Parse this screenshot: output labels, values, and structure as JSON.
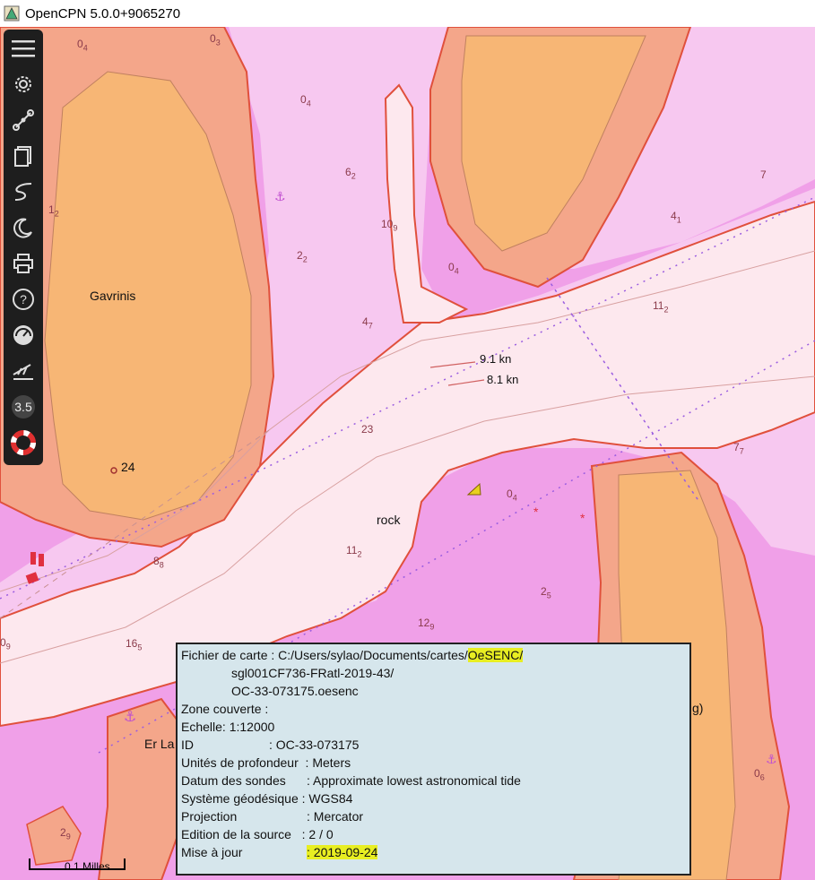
{
  "window": {
    "title": "OpenCPN 5.0.0+9065270"
  },
  "toolbar": {
    "items": [
      {
        "name": "menu",
        "icon": "hamburger-icon"
      },
      {
        "name": "options",
        "icon": "gear-icon"
      },
      {
        "name": "route",
        "icon": "route-icon"
      },
      {
        "name": "route-manager",
        "icon": "documents-icon"
      },
      {
        "name": "track",
        "icon": "track-icon"
      },
      {
        "name": "color-scheme",
        "icon": "moon-icon"
      },
      {
        "name": "print",
        "icon": "printer-icon"
      },
      {
        "name": "help",
        "icon": "help-icon"
      },
      {
        "name": "dashboard",
        "icon": "dashboard-icon"
      },
      {
        "name": "tides",
        "icon": "tide-icon"
      },
      {
        "name": "scale",
        "icon": "scale-icon",
        "label": "3.5"
      },
      {
        "name": "mob",
        "icon": "lifebuoy-icon"
      }
    ]
  },
  "map": {
    "labels": {
      "gavrinis": "Gavrinis",
      "rock": "rock",
      "current1": "9.1 kn",
      "current2": "8.1 kn",
      "peak": "24",
      "er_lan": "Er La",
      "g": "g)"
    },
    "soundings": [
      {
        "main": "0",
        "sub": "4"
      },
      {
        "main": "0",
        "sub": "3"
      },
      {
        "main": "0",
        "sub": "4"
      },
      {
        "main": "6",
        "sub": "2"
      },
      {
        "main": "1",
        "sub": "2"
      },
      {
        "main": "10",
        "sub": "9"
      },
      {
        "main": "2",
        "sub": "2"
      },
      {
        "main": "4",
        "sub": "7"
      },
      {
        "main": "0",
        "sub": "4"
      },
      {
        "main": "4",
        "sub": "1"
      },
      {
        "main": "7",
        "sub": ""
      },
      {
        "main": "11",
        "sub": "2"
      },
      {
        "main": "23",
        "sub": ""
      },
      {
        "main": "7",
        "sub": "7"
      },
      {
        "main": "0",
        "sub": "4"
      },
      {
        "main": "11",
        "sub": "2"
      },
      {
        "main": "8",
        "sub": "8"
      },
      {
        "main": "2",
        "sub": "5"
      },
      {
        "main": "12",
        "sub": "9"
      },
      {
        "main": "16",
        "sub": "5"
      },
      {
        "main": "0",
        "sub": "6"
      },
      {
        "main": "0",
        "sub": "9"
      },
      {
        "main": "2",
        "sub": "9"
      }
    ],
    "scale_label": "0.1 Milles"
  },
  "chart_info": {
    "file_label": "Fichier de carte :",
    "file_path_1": "C:/Users/sylao/Documents/cartes/",
    "file_path_hl": "OeSENC/",
    "file_path_2": "sgl001CF736-FRatl-2019-43/",
    "file_path_3": "OC-33-073175.oesenc",
    "zone": "Zone couverte  :",
    "scale": "Echelle:  1:12000",
    "id_label": "ID",
    "id_value": ": OC-33-073175",
    "depth_units_label": "Unités de profondeur",
    "depth_units_value": ": Meters",
    "datum_label": "Datum des sondes",
    "datum_value": ": Approximate lowest astronomical tide",
    "geodetic_label": "Système géodésique",
    "geodetic_value": ": WGS84",
    "projection_label": "Projection",
    "projection_value": ": Mercator",
    "edition_label": "Edition de la source",
    "edition_value": ": 2 / 0",
    "update_label": "Mise à jour",
    "update_prefix": ": ",
    "update_value": "2019-09-24"
  },
  "colors": {
    "land": "#f7b675",
    "drying": "#f4a68a",
    "shallow": "#f0a0e8",
    "medium": "#f7c8f0",
    "deep": "#fde8ee",
    "coast": "#e0503c",
    "channel": "#9b5de0",
    "highlight": "#e8ee22",
    "infobox": "#d6e6ec"
  }
}
